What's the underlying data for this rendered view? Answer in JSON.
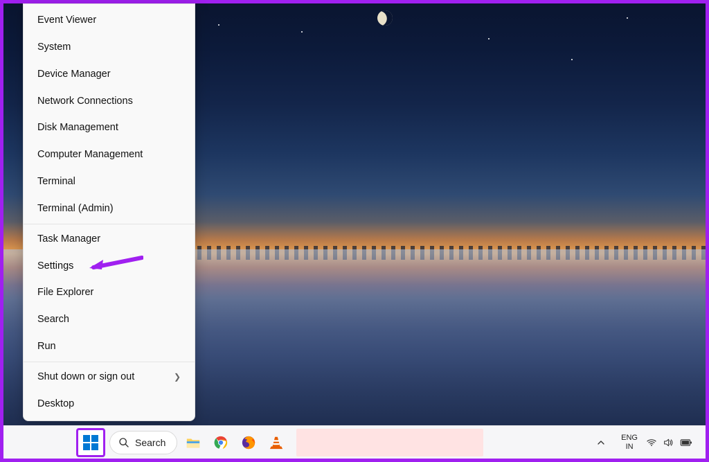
{
  "context_menu": {
    "groups": [
      [
        "Event Viewer",
        "System",
        "Device Manager",
        "Network Connections",
        "Disk Management",
        "Computer Management",
        "Terminal",
        "Terminal (Admin)"
      ],
      [
        "Task Manager",
        "Settings",
        "File Explorer",
        "Search",
        "Run"
      ],
      [
        "Shut down or sign out",
        "Desktop"
      ]
    ],
    "submenu_item": "Shut down or sign out",
    "highlighted_item": "Settings"
  },
  "annotation": {
    "arrow_color": "#a020f0",
    "target": "Settings"
  },
  "taskbar": {
    "search_label": "Search",
    "lang_top": "ENG",
    "lang_bottom": "IN",
    "pinned": [
      {
        "name": "file-explorer-icon"
      },
      {
        "name": "chrome-icon"
      },
      {
        "name": "firefox-icon"
      },
      {
        "name": "vlc-icon"
      }
    ]
  }
}
